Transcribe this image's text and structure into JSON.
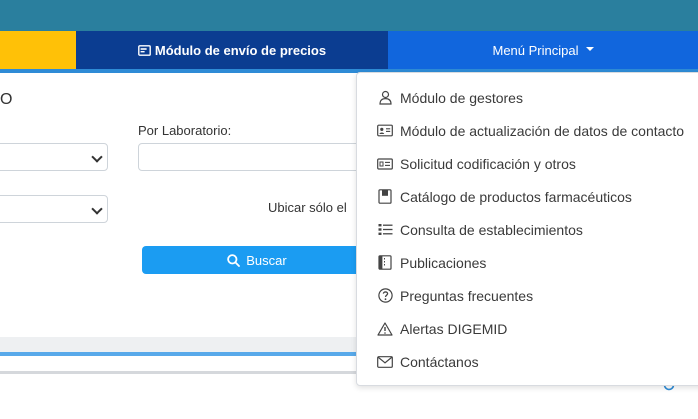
{
  "nav": {
    "envio_label": "Módulo de envío de precios",
    "menu_label": "Menú Principal"
  },
  "search": {
    "title_fragment": "O",
    "laboratorio_label": "Por Laboratorio:",
    "ubicar_label": "Ubicar sólo el",
    "buscar_label": "Buscar"
  },
  "menu": {
    "items": [
      {
        "label": "Módulo de gestores",
        "icon": "person-icon"
      },
      {
        "label": "Módulo de actualización de datos de contacto",
        "icon": "id-card-icon"
      },
      {
        "label": "Solicitud codificación y otros",
        "icon": "card-list-icon"
      },
      {
        "label": "Catálogo de productos farmacéuticos",
        "icon": "book-icon"
      },
      {
        "label": "Consulta de establecimientos",
        "icon": "list-icon"
      },
      {
        "label": "Publicaciones",
        "icon": "journal-icon"
      },
      {
        "label": "Preguntas frecuentes",
        "icon": "question-circle-icon"
      },
      {
        "label": "Alertas DIGEMID",
        "icon": "warning-icon"
      },
      {
        "label": "Contáctanos",
        "icon": "envelope-icon"
      }
    ]
  },
  "colors": {
    "topbar": "#2a7f9e",
    "nav_yellow": "#ffc107",
    "nav_dark_blue": "#0b3d91",
    "nav_blue": "#1166dd",
    "buscar_button": "#1b9cf2"
  }
}
